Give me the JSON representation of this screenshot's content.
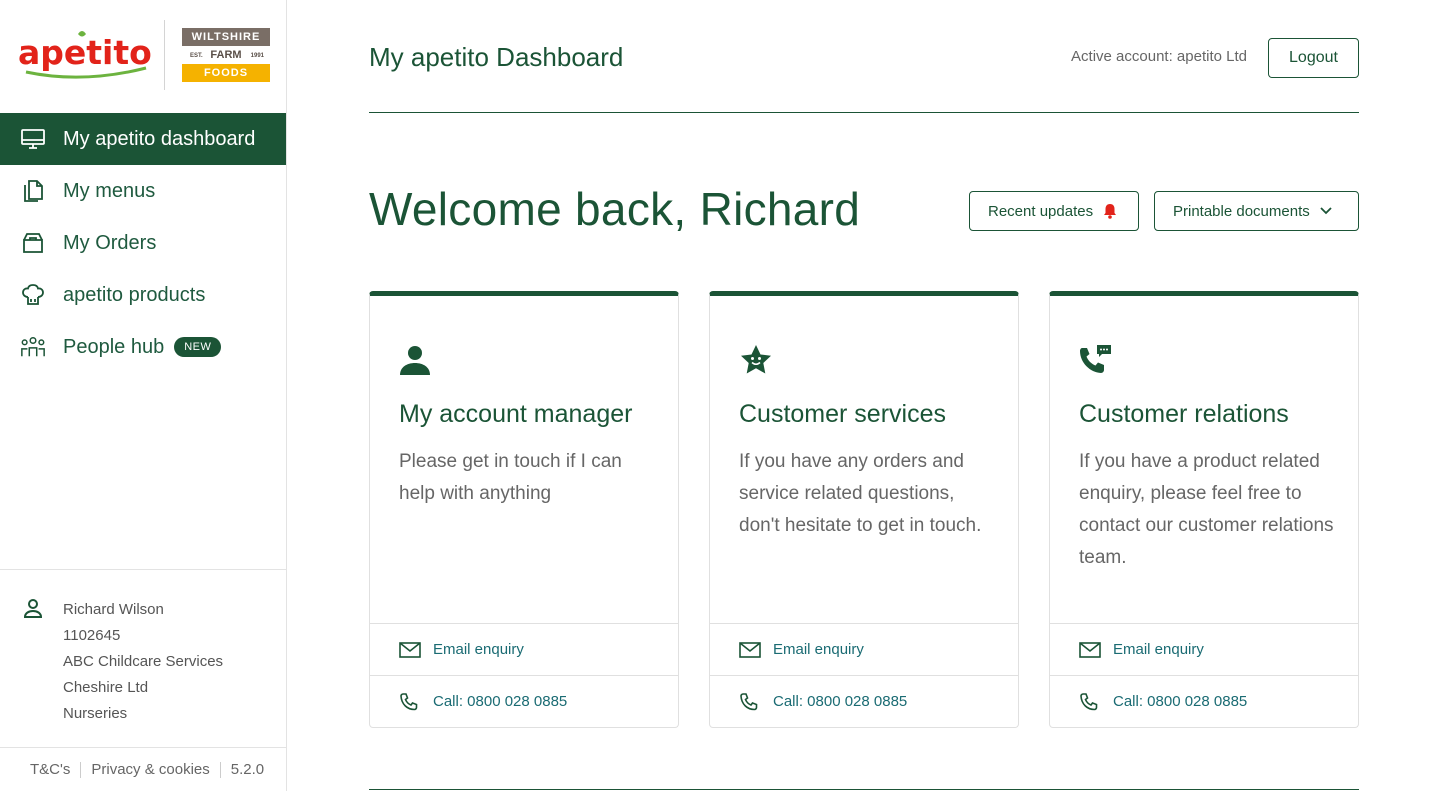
{
  "brand": {
    "apetito_logo": "apetito",
    "wf_top": "WILTSHIRE",
    "wf_est": "EST.",
    "wf_mid": "FARM",
    "wf_year": "1991",
    "wf_bottom": "FOODS"
  },
  "sidebar": {
    "items": [
      {
        "label": "My apetito dashboard",
        "icon": "monitor-icon",
        "active": true
      },
      {
        "label": "My menus",
        "icon": "documents-icon"
      },
      {
        "label": "My Orders",
        "icon": "box-icon"
      },
      {
        "label": "apetito products",
        "icon": "chef-hat-icon"
      },
      {
        "label": "People hub",
        "icon": "people-icon",
        "badge": "NEW"
      }
    ],
    "user": {
      "name": "Richard Wilson",
      "id": "1102645",
      "company": "ABC Childcare Services",
      "region": "Cheshire Ltd",
      "type": "Nurseries"
    },
    "footer": {
      "terms": "T&C's",
      "privacy": "Privacy & cookies",
      "version": "5.2.0"
    }
  },
  "header": {
    "title": "My apetito Dashboard",
    "active_account": "Active account: apetito Ltd",
    "logout": "Logout"
  },
  "main": {
    "welcome": "Welcome back, Richard",
    "recent_updates": "Recent updates",
    "printable_documents": "Printable documents",
    "cards": [
      {
        "icon": "person-icon",
        "title": "My account manager",
        "text": "Please get in touch if I can help with anything",
        "email": "Email enquiry",
        "call": "Call: 0800 028 0885"
      },
      {
        "icon": "star-face-icon",
        "title": "Customer services",
        "text": "If you have any orders and service related questions, don't hesitate to get in touch.",
        "email": "Email enquiry",
        "call": "Call: 0800 028 0885"
      },
      {
        "icon": "phone-chat-icon",
        "title": "Customer relations",
        "text": "If you have a product related enquiry, please feel free to contact our customer relations team.",
        "email": "Email enquiry",
        "call": "Call: 0800 028 0885"
      }
    ]
  },
  "colors": {
    "brand_green": "#1b5436",
    "accent_red": "#e2231a",
    "link_teal": "#1a6b73",
    "wf_gold": "#f5b200"
  }
}
